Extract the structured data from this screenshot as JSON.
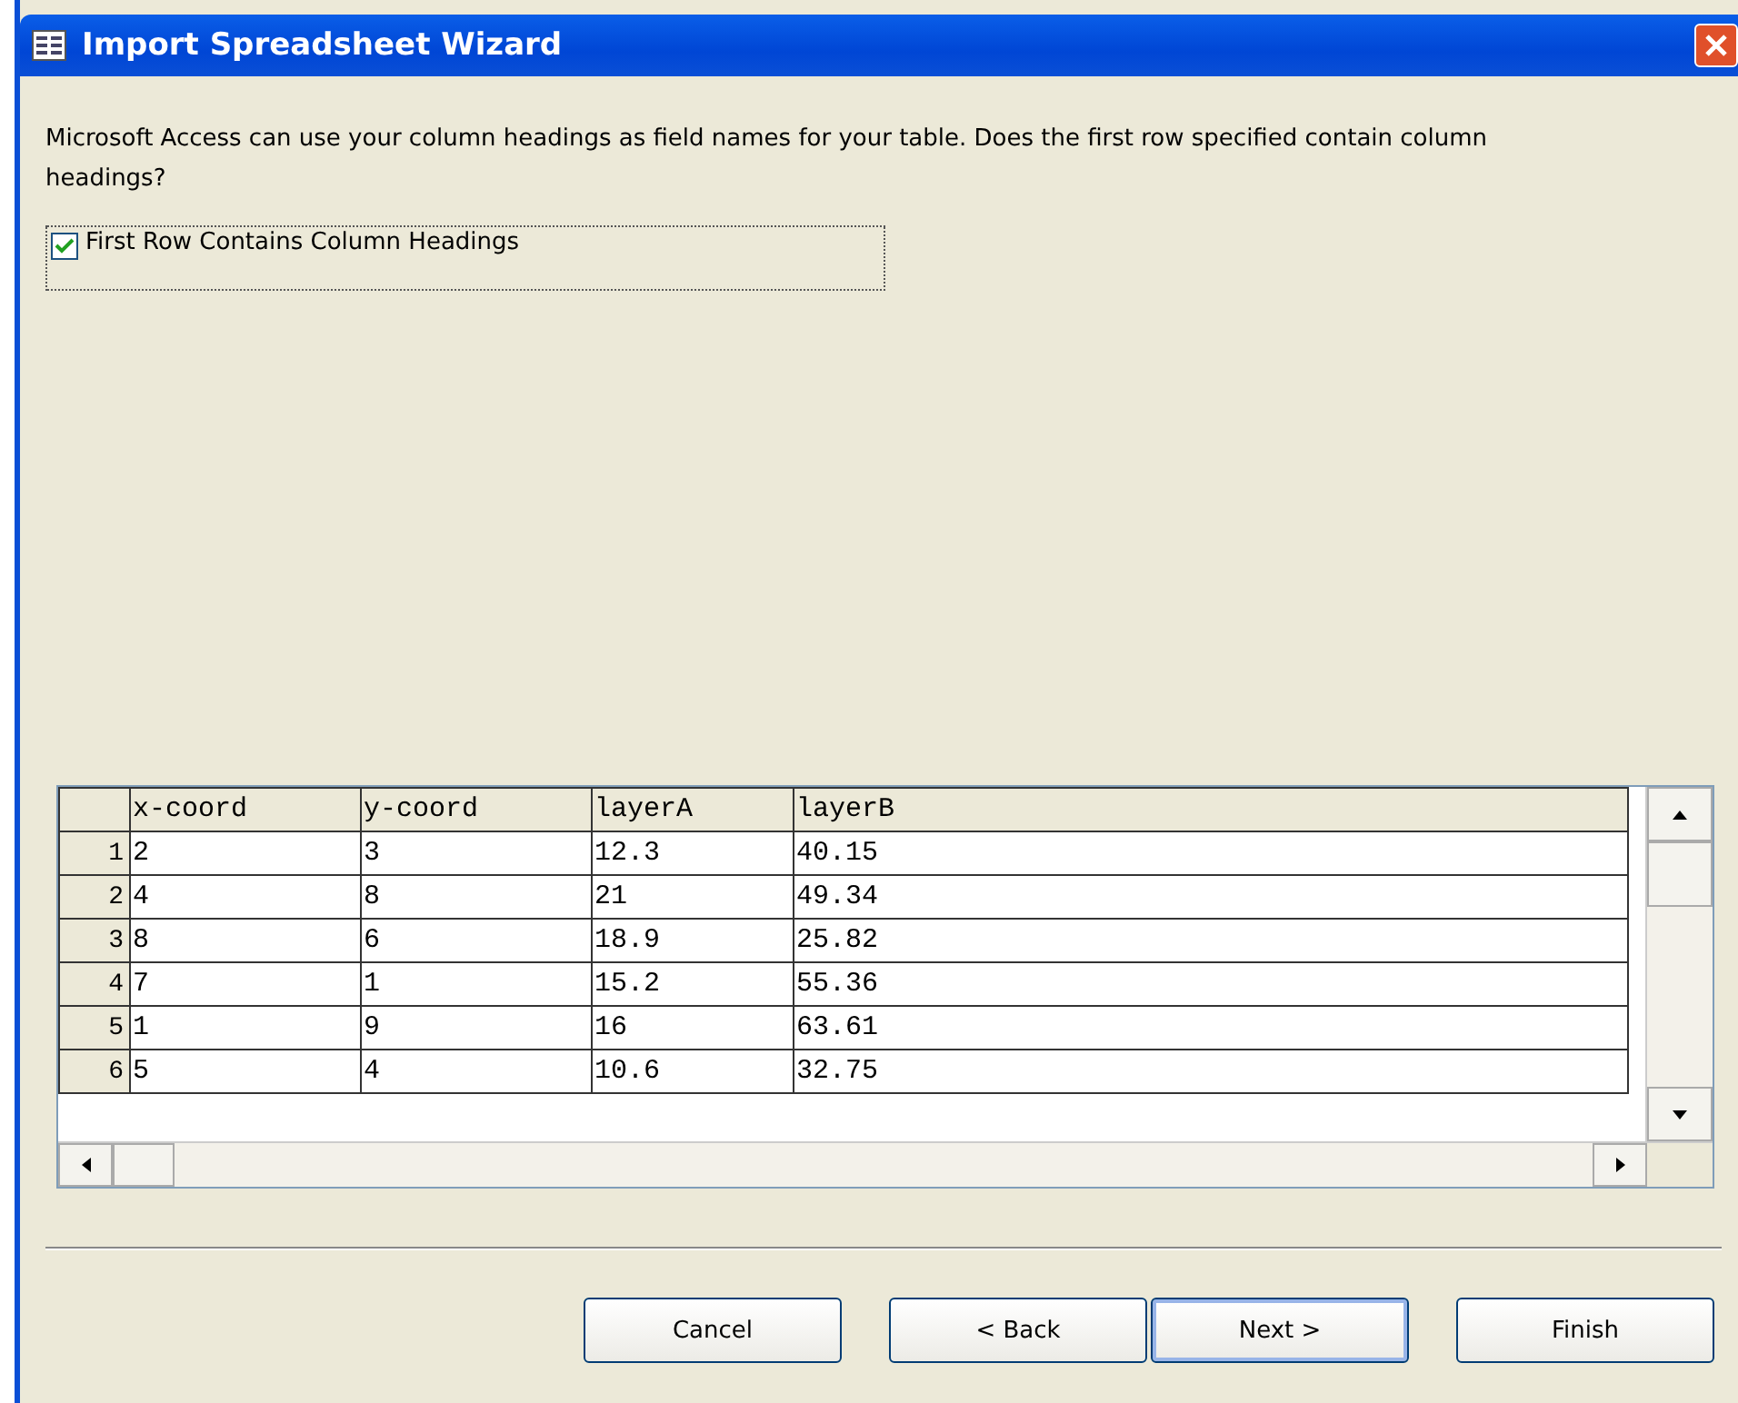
{
  "window": {
    "title": "Import Spreadsheet Wizard"
  },
  "instructions": "Microsoft Access can use your column headings as field names for your table. Does the first row specified contain column headings?",
  "first_row_option": {
    "label": "First Row Contains Column Headings",
    "checked": true
  },
  "table": {
    "columns": [
      "x-coord",
      "y-coord",
      "layerA",
      "layerB"
    ],
    "rows": [
      {
        "number": "1",
        "cells": [
          "2",
          "3",
          "12.3",
          "40.15"
        ]
      },
      {
        "number": "2",
        "cells": [
          "4",
          "8",
          "21",
          "49.34"
        ]
      },
      {
        "number": "3",
        "cells": [
          "8",
          "6",
          "18.9",
          "25.82"
        ]
      },
      {
        "number": "4",
        "cells": [
          "7",
          "1",
          "15.2",
          "55.36"
        ]
      },
      {
        "number": "5",
        "cells": [
          "1",
          "9",
          "16",
          "63.61"
        ]
      },
      {
        "number": "6",
        "cells": [
          "5",
          "4",
          "10.6",
          "32.75"
        ]
      }
    ]
  },
  "buttons": [
    {
      "label": "Cancel",
      "default": false
    },
    {
      "label": "< Back",
      "default": false
    },
    {
      "label": "Next >",
      "default": true
    },
    {
      "label": "Finish",
      "default": false
    }
  ]
}
